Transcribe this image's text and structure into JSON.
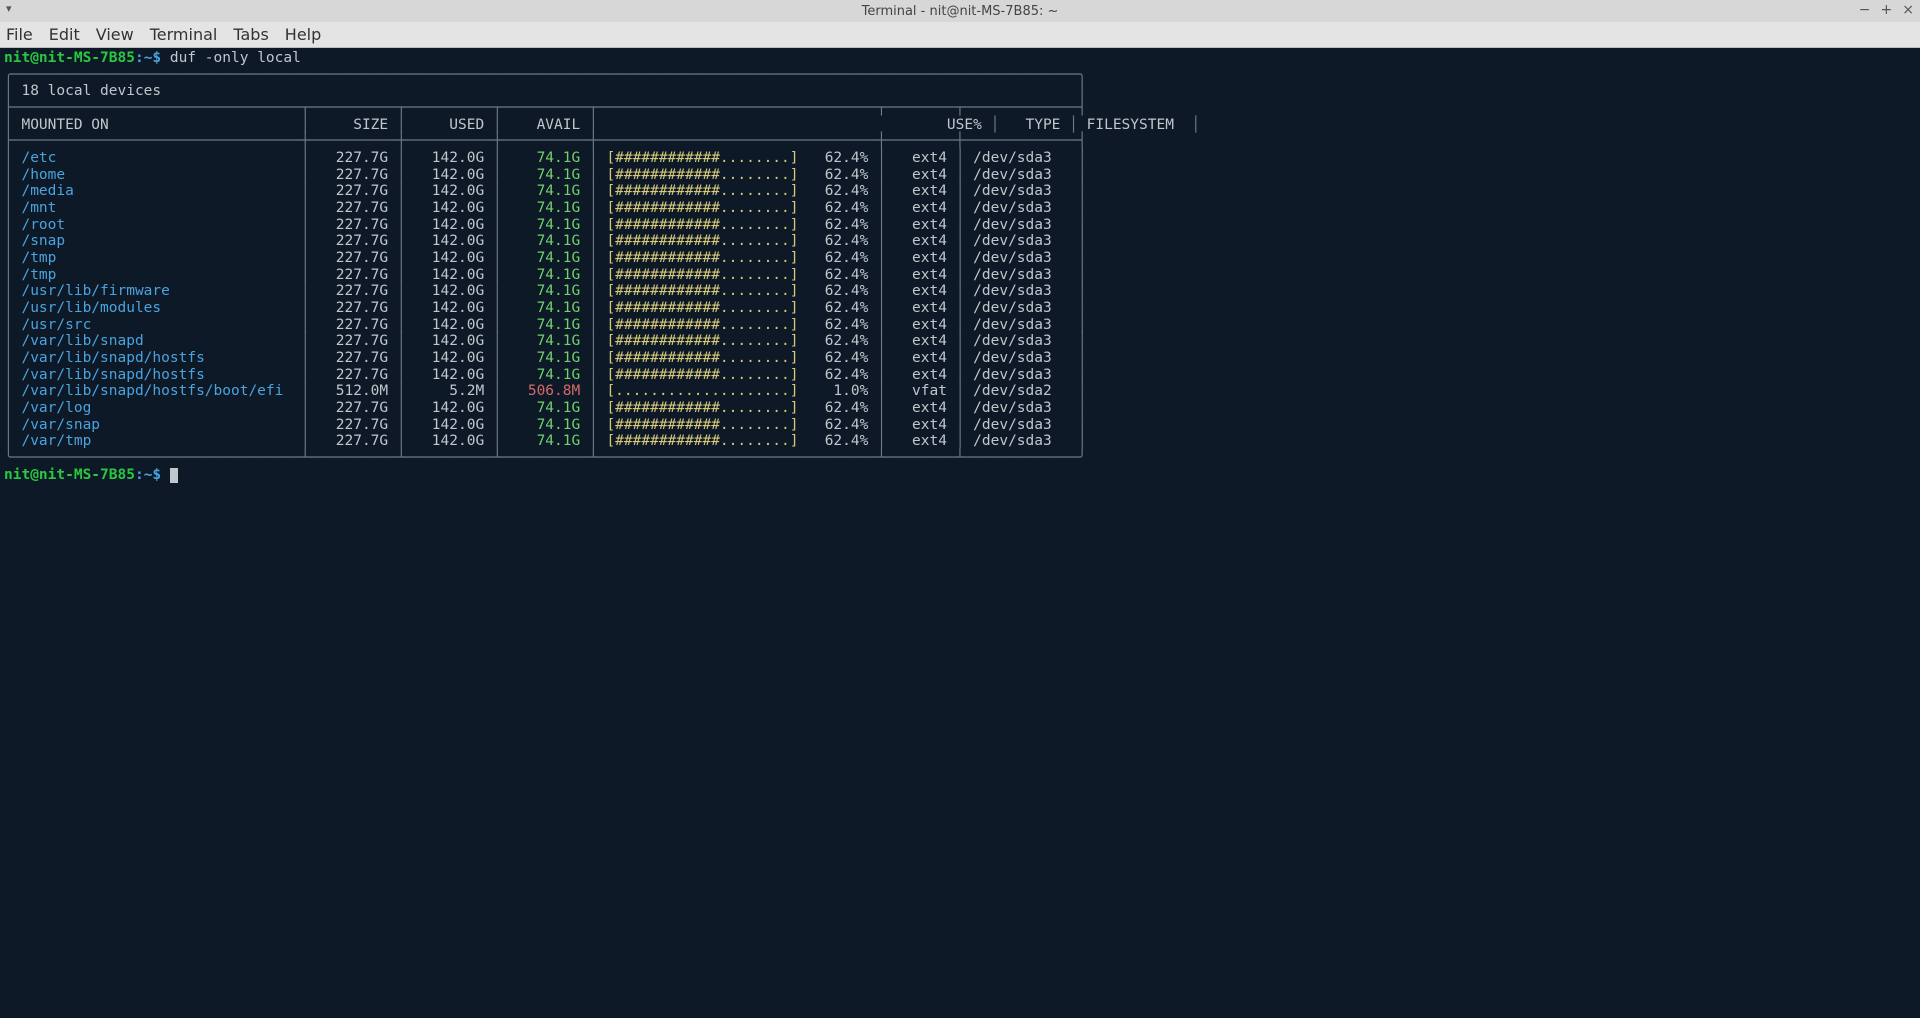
{
  "window": {
    "title": "Terminal - nit@nit-MS-7B85: ~"
  },
  "menu": [
    "File",
    "Edit",
    "View",
    "Terminal",
    "Tabs",
    "Help"
  ],
  "prompt": {
    "user_host": "nit@nit-MS-7B85",
    "path": "~",
    "sep": ":",
    "dollar": "$"
  },
  "command": "duf -only local",
  "table": {
    "caption": "18 local devices",
    "headers": [
      "MOUNTED ON",
      "SIZE",
      "USED",
      "AVAIL",
      "USE%",
      "TYPE",
      "FILESYSTEM"
    ],
    "rows": [
      {
        "mounted_on": "/etc",
        "size": "227.7G",
        "used": "142.0G",
        "avail": "74.1G",
        "bar": "[############........]",
        "pct": "62.4%",
        "type": "ext4",
        "fs": "/dev/sda3",
        "avail_red": false
      },
      {
        "mounted_on": "/home",
        "size": "227.7G",
        "used": "142.0G",
        "avail": "74.1G",
        "bar": "[############........]",
        "pct": "62.4%",
        "type": "ext4",
        "fs": "/dev/sda3",
        "avail_red": false
      },
      {
        "mounted_on": "/media",
        "size": "227.7G",
        "used": "142.0G",
        "avail": "74.1G",
        "bar": "[############........]",
        "pct": "62.4%",
        "type": "ext4",
        "fs": "/dev/sda3",
        "avail_red": false
      },
      {
        "mounted_on": "/mnt",
        "size": "227.7G",
        "used": "142.0G",
        "avail": "74.1G",
        "bar": "[############........]",
        "pct": "62.4%",
        "type": "ext4",
        "fs": "/dev/sda3",
        "avail_red": false
      },
      {
        "mounted_on": "/root",
        "size": "227.7G",
        "used": "142.0G",
        "avail": "74.1G",
        "bar": "[############........]",
        "pct": "62.4%",
        "type": "ext4",
        "fs": "/dev/sda3",
        "avail_red": false
      },
      {
        "mounted_on": "/snap",
        "size": "227.7G",
        "used": "142.0G",
        "avail": "74.1G",
        "bar": "[############........]",
        "pct": "62.4%",
        "type": "ext4",
        "fs": "/dev/sda3",
        "avail_red": false
      },
      {
        "mounted_on": "/tmp",
        "size": "227.7G",
        "used": "142.0G",
        "avail": "74.1G",
        "bar": "[############........]",
        "pct": "62.4%",
        "type": "ext4",
        "fs": "/dev/sda3",
        "avail_red": false
      },
      {
        "mounted_on": "/tmp",
        "size": "227.7G",
        "used": "142.0G",
        "avail": "74.1G",
        "bar": "[############........]",
        "pct": "62.4%",
        "type": "ext4",
        "fs": "/dev/sda3",
        "avail_red": false
      },
      {
        "mounted_on": "/usr/lib/firmware",
        "size": "227.7G",
        "used": "142.0G",
        "avail": "74.1G",
        "bar": "[############........]",
        "pct": "62.4%",
        "type": "ext4",
        "fs": "/dev/sda3",
        "avail_red": false
      },
      {
        "mounted_on": "/usr/lib/modules",
        "size": "227.7G",
        "used": "142.0G",
        "avail": "74.1G",
        "bar": "[############........]",
        "pct": "62.4%",
        "type": "ext4",
        "fs": "/dev/sda3",
        "avail_red": false
      },
      {
        "mounted_on": "/usr/src",
        "size": "227.7G",
        "used": "142.0G",
        "avail": "74.1G",
        "bar": "[############........]",
        "pct": "62.4%",
        "type": "ext4",
        "fs": "/dev/sda3",
        "avail_red": false
      },
      {
        "mounted_on": "/var/lib/snapd",
        "size": "227.7G",
        "used": "142.0G",
        "avail": "74.1G",
        "bar": "[############........]",
        "pct": "62.4%",
        "type": "ext4",
        "fs": "/dev/sda3",
        "avail_red": false
      },
      {
        "mounted_on": "/var/lib/snapd/hostfs",
        "size": "227.7G",
        "used": "142.0G",
        "avail": "74.1G",
        "bar": "[############........]",
        "pct": "62.4%",
        "type": "ext4",
        "fs": "/dev/sda3",
        "avail_red": false
      },
      {
        "mounted_on": "/var/lib/snapd/hostfs",
        "size": "227.7G",
        "used": "142.0G",
        "avail": "74.1G",
        "bar": "[############........]",
        "pct": "62.4%",
        "type": "ext4",
        "fs": "/dev/sda3",
        "avail_red": false
      },
      {
        "mounted_on": "/var/lib/snapd/hostfs/boot/efi",
        "size": "512.0M",
        "used": "5.2M",
        "avail": "506.8M",
        "bar": "[....................]",
        "pct": "1.0%",
        "type": "vfat",
        "fs": "/dev/sda2",
        "avail_red": true
      },
      {
        "mounted_on": "/var/log",
        "size": "227.7G",
        "used": "142.0G",
        "avail": "74.1G",
        "bar": "[############........]",
        "pct": "62.4%",
        "type": "ext4",
        "fs": "/dev/sda3",
        "avail_red": false
      },
      {
        "mounted_on": "/var/snap",
        "size": "227.7G",
        "used": "142.0G",
        "avail": "74.1G",
        "bar": "[############........]",
        "pct": "62.4%",
        "type": "ext4",
        "fs": "/dev/sda3",
        "avail_red": false
      },
      {
        "mounted_on": "/var/tmp",
        "size": "227.7G",
        "used": "142.0G",
        "avail": "74.1G",
        "bar": "[############........]",
        "pct": "62.4%",
        "type": "ext4",
        "fs": "/dev/sda3",
        "avail_red": false
      }
    ]
  }
}
